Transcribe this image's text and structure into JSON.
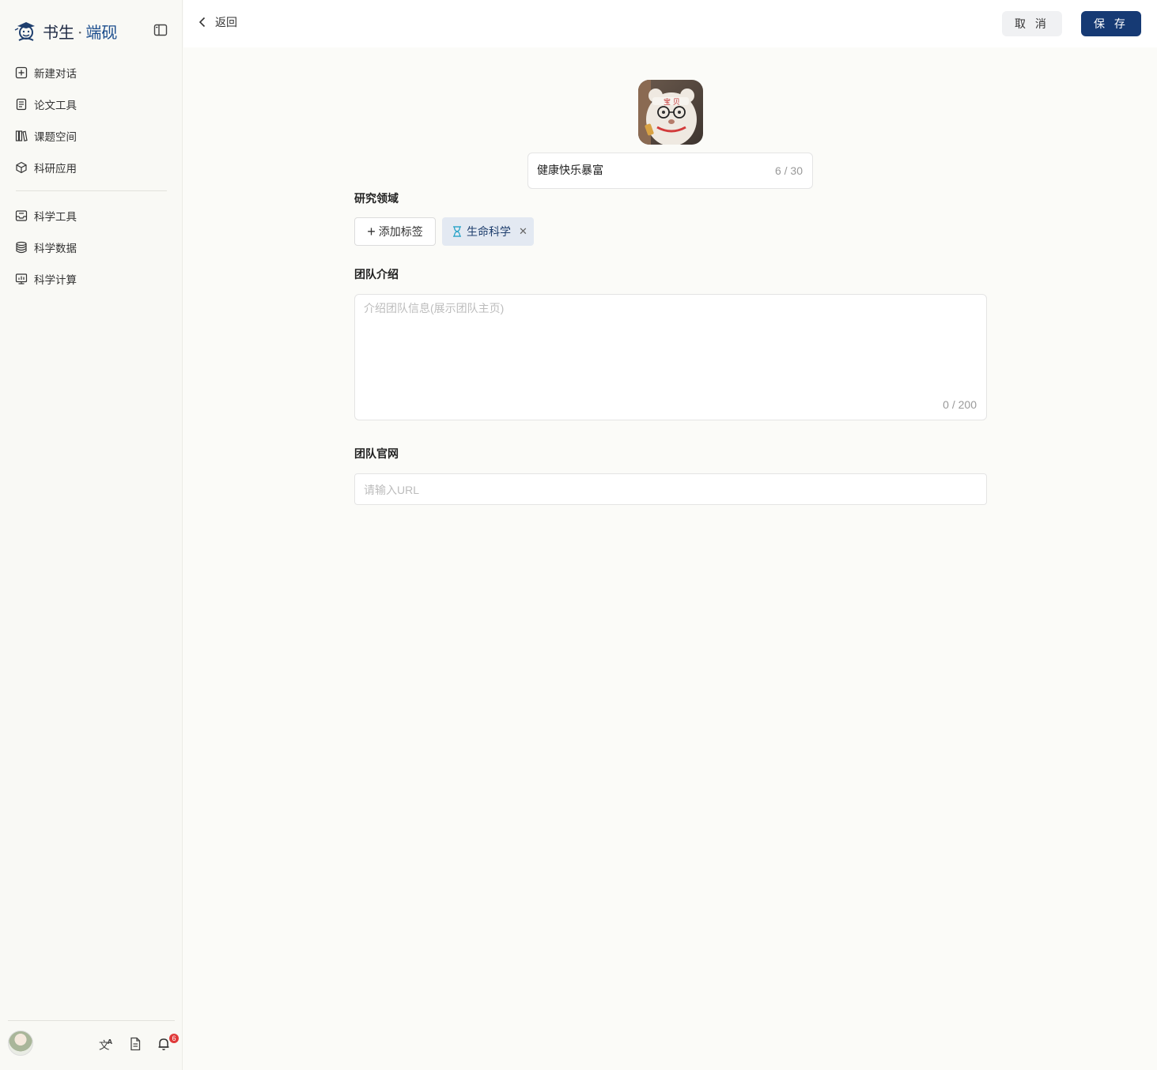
{
  "brand": {
    "name_part1": "书生",
    "separator": "·",
    "name_part2": "端砚"
  },
  "sidebar": {
    "items": [
      {
        "label": "新建对话",
        "icon": "plus-square-icon"
      },
      {
        "label": "论文工具",
        "icon": "document-icon"
      },
      {
        "label": "课题空间",
        "icon": "books-icon"
      },
      {
        "label": "科研应用",
        "icon": "cube-icon"
      },
      {
        "label": "科学工具",
        "icon": "toolbox-icon"
      },
      {
        "label": "科学数据",
        "icon": "database-icon"
      },
      {
        "label": "科学计算",
        "icon": "monitor-chart-icon"
      }
    ],
    "footer": {
      "notification_count": "6"
    }
  },
  "topbar": {
    "back_label": "返回",
    "cancel_label": "取 消",
    "save_label": "保 存"
  },
  "form": {
    "team_name": {
      "value": "健康快乐暴富",
      "count": "6 / 30"
    },
    "research_field": {
      "label": "研究领域",
      "add_tag_label": "添加标签",
      "tags": [
        "生命科学"
      ]
    },
    "intro": {
      "label": "团队介绍",
      "placeholder": "介绍团队信息(展示团队主页)",
      "count": "0 / 200"
    },
    "website": {
      "label": "团队官网",
      "placeholder": "请输入URL"
    }
  },
  "colors": {
    "primary": "#163a74",
    "sidebar_bg": "#f9f9f5",
    "tag_bg": "#e3e9f2",
    "badge": "#e03a3a"
  }
}
